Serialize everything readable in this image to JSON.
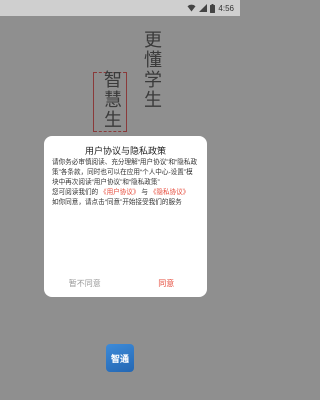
{
  "status_bar": {
    "time": "4:56",
    "icons": [
      "wifi-icon",
      "signal-icon",
      "battery-icon"
    ]
  },
  "background": {
    "slogan": "更懂学生",
    "brand": "智慧生"
  },
  "dialog": {
    "title": "用户协议与隐私政策",
    "para1": "请你务必审慎阅读、充分理解“用户协议”和“隐私政策”各条款，同时也可以在应用“个人中心-设置”模块中再次阅读“用户协议”和“隐私政策”",
    "para2_prefix": "您可阅读我们的",
    "link_user_agreement": "《用户协议》",
    "para2_middle": "与",
    "link_privacy_policy": "《隐私协议》",
    "para3": "如你同意，请点击“同意”开始接受我们的服务",
    "disagree_label": "暂不同意",
    "agree_label": "同意"
  },
  "app_icon": {
    "label": "智通"
  },
  "colors": {
    "accent": "#e64a3a",
    "overlay": "#8f8f8f",
    "app_icon_blue": "#2f7ac9"
  }
}
